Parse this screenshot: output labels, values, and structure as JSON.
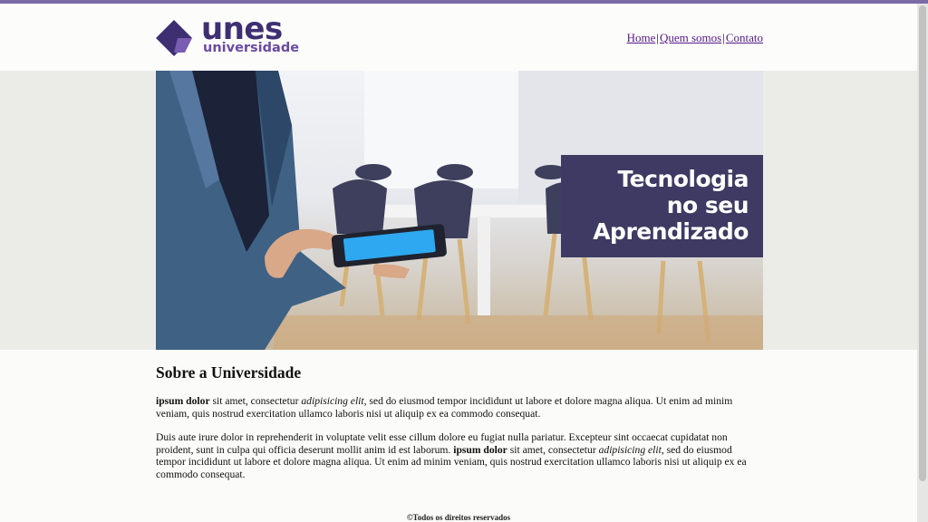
{
  "colors": {
    "accent_bar": "#7b6aa6",
    "logo_primary": "#3e2f73",
    "logo_secondary": "#6a4aa3",
    "caption_bg": "#3e3a63",
    "link": "#551a8b"
  },
  "logo": {
    "icon": "diamond-logo-icon",
    "main": "unes",
    "sub": "universidade"
  },
  "nav": {
    "items": [
      {
        "label": "Home"
      },
      {
        "label": "Quem somos"
      },
      {
        "label": "Contato"
      }
    ],
    "separator": "|"
  },
  "hero": {
    "caption_lines": [
      "Tecnologia",
      "no seu",
      "Aprendizado"
    ]
  },
  "content": {
    "title": "Sobre a Universidade",
    "p1": {
      "bold": "ipsum dolor",
      "t1": " sit amet, consectetur ",
      "italic": "adipisicing elit",
      "t2": ", sed do eiusmod tempor incididunt ut labore et dolore magna aliqua. Ut enim ad minim veniam, quis nostrud exercitation ullamco laboris nisi ut aliquip ex ea commodo consequat."
    },
    "p2": {
      "t0": "Duis aute irure dolor in reprehenderit in voluptate velit esse cillum dolore eu fugiat nulla pariatur. Excepteur sint occaecat cupidatat non proident, sunt in culpa qui officia deserunt mollit anim id est laborum. ",
      "bold": "ipsum dolor",
      "t1": " sit amet, consectetur ",
      "italic": "adipisicing elit",
      "t2": ", sed do eiusmod tempor incididunt ut labore et dolore magna aliqua. Ut enim ad minim veniam, quis nostrud exercitation ullamco laboris nisi ut aliquip ex ea commodo consequat."
    }
  },
  "footer": {
    "text": "©Todos os direitos reservados"
  }
}
